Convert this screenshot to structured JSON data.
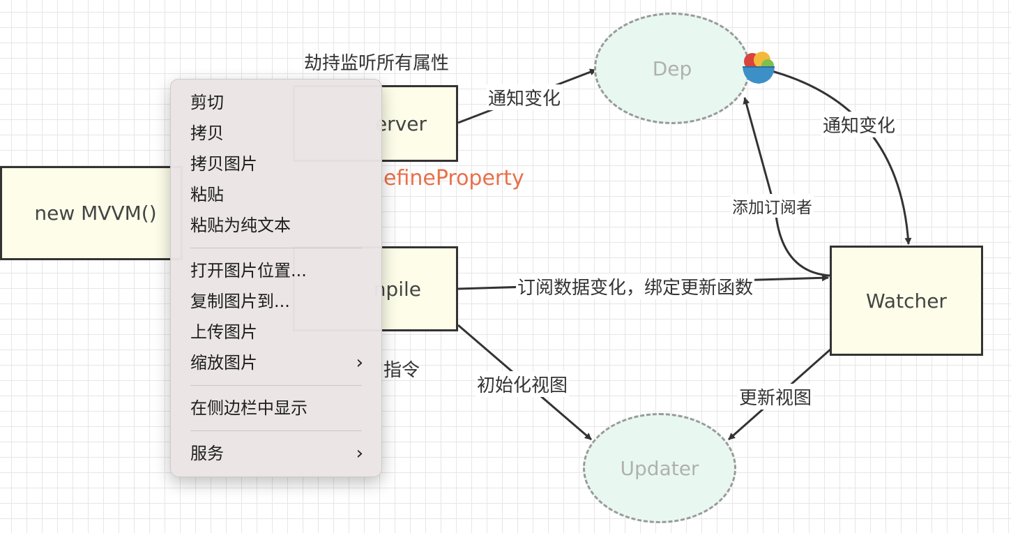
{
  "diagram": {
    "new_mvvm": "new MVVM()",
    "observer": "Observer",
    "observer_visible": "erver",
    "compile": "Compile",
    "compile_visible": "npile",
    "watcher": "Watcher",
    "dep": "Dep",
    "updater": "Updater",
    "labels": {
      "hijack": "劫持监听所有属性",
      "define_property": "efineProperty",
      "notify_dep": "通知变化",
      "notify_watcher": "通知变化",
      "add_subscriber": "添加订阅者",
      "subscribe": "订阅数据变化，绑定更新函数",
      "directive": "指令",
      "init_view": "初始化视图",
      "update_view": "更新视图"
    }
  },
  "context_menu": {
    "items": [
      {
        "label": "剪切"
      },
      {
        "label": "拷贝"
      },
      {
        "label": "拷贝图片"
      },
      {
        "label": "粘贴"
      },
      {
        "label": "粘贴为纯文本"
      },
      {
        "label": "打开图片位置..."
      },
      {
        "label": "复制图片到..."
      },
      {
        "label": "上传图片"
      },
      {
        "label": "缩放图片",
        "submenu": "›"
      },
      {
        "label": "在侧边栏中显示"
      },
      {
        "label": "服务",
        "submenu": "›"
      }
    ]
  },
  "colors": {
    "box_fill": "#fdfde9",
    "ellipse_fill": "#e8f8f1",
    "accent_orange": "#e8704a"
  }
}
